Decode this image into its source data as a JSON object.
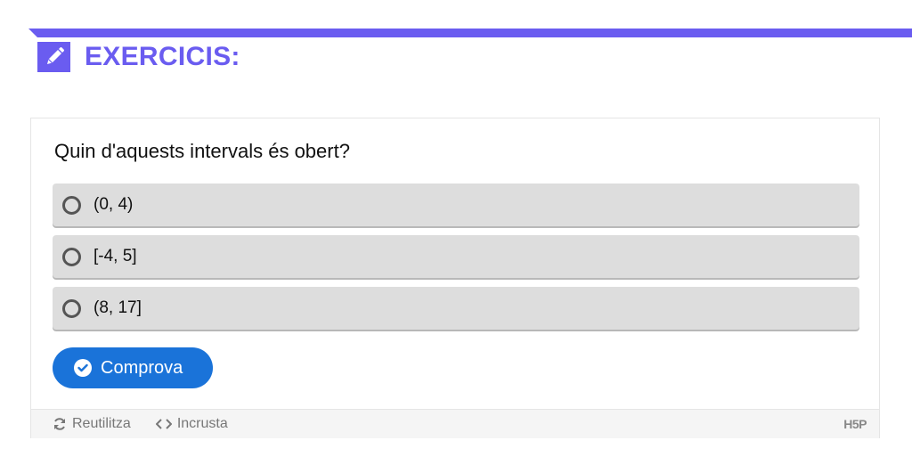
{
  "header": {
    "title": "EXERCICIS:",
    "icon": "pencil-icon",
    "accent_color": "#6a5cf0"
  },
  "question": {
    "text": "Quin d'aquests intervals és obert?"
  },
  "answers": [
    {
      "label": "(0, 4)",
      "selected": false
    },
    {
      "label": "[-4, 5]",
      "selected": false
    },
    {
      "label": "(8, 17]",
      "selected": false
    }
  ],
  "check_button": {
    "label": "Comprova",
    "icon": "check-circle-icon",
    "color": "#1a73d9"
  },
  "footer": {
    "reuse_label": "Reutilitza",
    "reuse_icon": "refresh-icon",
    "embed_label": "Incrusta",
    "embed_icon": "code-icon",
    "logo_text": "H5P"
  }
}
